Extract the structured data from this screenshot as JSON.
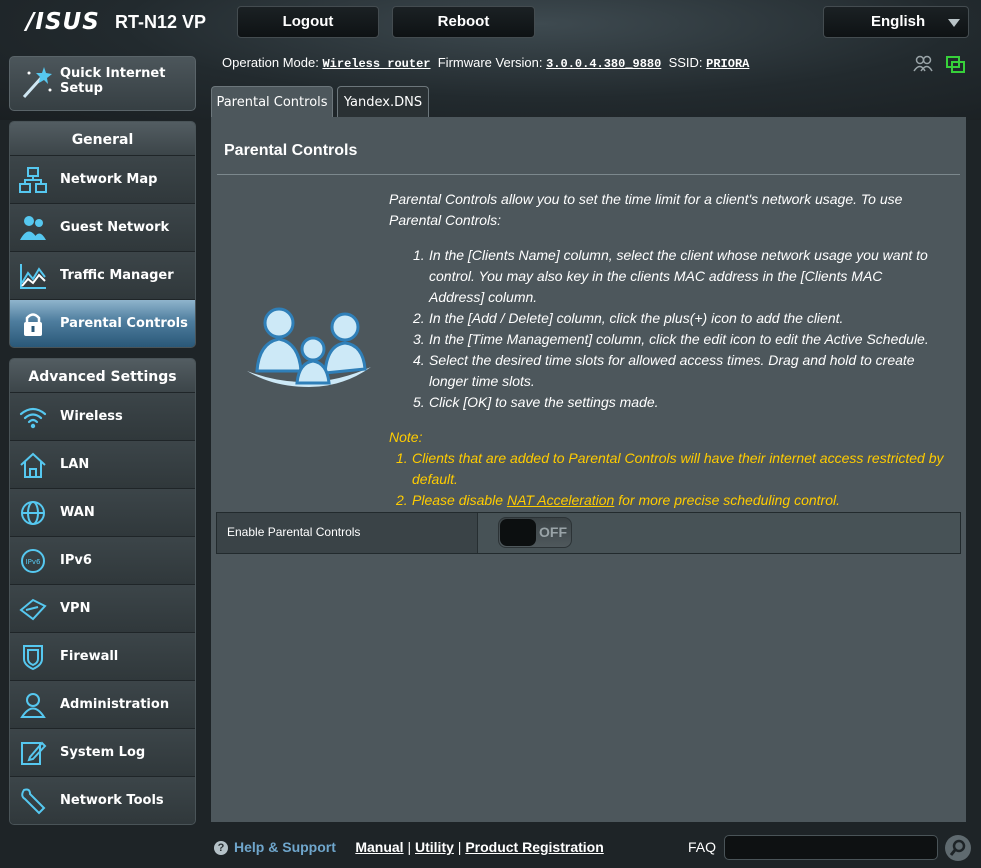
{
  "header": {
    "logo": "/ISUS",
    "model": "RT-N12 VP",
    "logout_label": "Logout",
    "reboot_label": "Reboot",
    "language": "English"
  },
  "info": {
    "op_mode_label": "Operation Mode:",
    "op_mode_value": "Wireless router",
    "firmware_label": "Firmware Version:",
    "firmware_value": "3.0.0.4.380_9880",
    "ssid_label": "SSID:",
    "ssid_value": "PRIORA"
  },
  "sidebar": {
    "quick_setup": "Quick Internet Setup",
    "general_title": "General",
    "general_items": [
      {
        "label": "Network Map",
        "icon": "network-map-icon"
      },
      {
        "label": "Guest Network",
        "icon": "guest-network-icon"
      },
      {
        "label": "Traffic Manager",
        "icon": "traffic-manager-icon"
      },
      {
        "label": "Parental Controls",
        "icon": "lock-icon",
        "active": true
      }
    ],
    "advanced_title": "Advanced Settings",
    "advanced_items": [
      {
        "label": "Wireless",
        "icon": "wifi-icon"
      },
      {
        "label": "LAN",
        "icon": "home-icon"
      },
      {
        "label": "WAN",
        "icon": "globe-icon"
      },
      {
        "label": "IPv6",
        "icon": "ipv6-icon"
      },
      {
        "label": "VPN",
        "icon": "vpn-icon"
      },
      {
        "label": "Firewall",
        "icon": "shield-icon"
      },
      {
        "label": "Administration",
        "icon": "admin-user-icon"
      },
      {
        "label": "System Log",
        "icon": "log-edit-icon"
      },
      {
        "label": "Network Tools",
        "icon": "wrench-icon"
      }
    ]
  },
  "tabs": [
    {
      "label": "Parental Controls",
      "active": true
    },
    {
      "label": "Yandex.DNS",
      "active": false
    }
  ],
  "main": {
    "title": "Parental Controls",
    "description": "Parental Controls allow you to set the time limit for a client's network usage. To use Parental Controls:",
    "steps": [
      {
        "n": "1.",
        "text": "In the [Clients Name] column, select the client whose network usage you want to control. You may also key in the clients MAC address in the [Clients MAC Address] column."
      },
      {
        "n": "2.",
        "text": "In the [Add / Delete] column, click the plus(+) icon to add the client."
      },
      {
        "n": "3.",
        "text": "In the [Time Management] column, click the edit icon to edit the Active Schedule."
      },
      {
        "n": "4.",
        "text": "Select the desired time slots for allowed access times. Drag and hold to create longer time slots."
      },
      {
        "n": "5.",
        "text": "Click [OK] to save the settings made."
      }
    ],
    "note_title": "Note:",
    "note_1_n": "1.",
    "note_1": "Clients that are added to Parental Controls will have their internet access restricted by default.",
    "note_2_n": "2.",
    "note_2_pre": "Please disable ",
    "note_2_link": "NAT Acceleration",
    "note_2_post": " for more precise scheduling control.",
    "enable_label": "Enable Parental Controls",
    "toggle_state": "OFF"
  },
  "footer": {
    "help_q": "?",
    "help": "Help & Support",
    "manual": "Manual",
    "sep": "|",
    "utility": "Utility",
    "registration": "Product Registration",
    "faq": "FAQ"
  },
  "colors": {
    "accent_blue": "#6fa6cc",
    "note_yellow": "#ffcc00",
    "icon_cyan": "#56c8f0",
    "status_green": "#37d13a"
  }
}
